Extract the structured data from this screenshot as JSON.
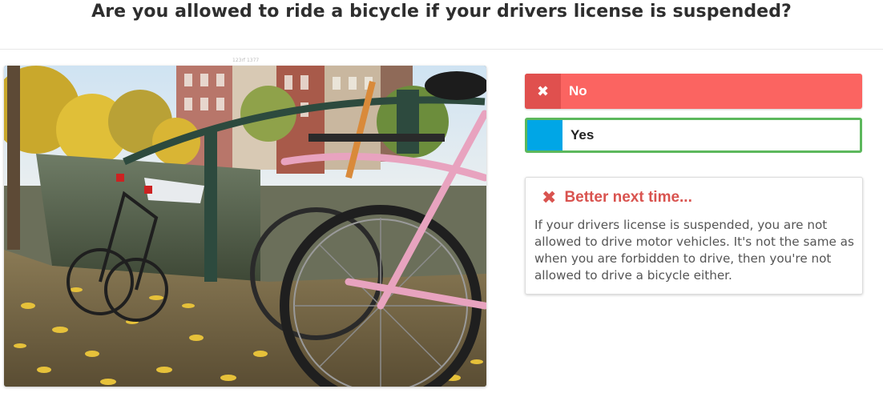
{
  "question": {
    "title": "Are you allowed to ride a bicycle if your drivers license is suspended?"
  },
  "image": {
    "subject": "bicycles-parked-at-canal-railing",
    "credit": "123rf 1377"
  },
  "answers": [
    {
      "label": "No",
      "state": "selected-wrong",
      "icon": "times-icon",
      "color": "#fb6461"
    },
    {
      "label": "Yes",
      "state": "correct",
      "color": "#00a6e6",
      "border_color": "#5cb85c"
    }
  ],
  "feedback": {
    "icon": "times-icon",
    "heading": "Better next time...",
    "heading_color": "#d9534f",
    "body": "If your drivers license is suspended, you are not allowed to drive motor vehicles. It's not the same as when you are forbidden to drive, then you're not allowed to drive a bicycle either."
  }
}
